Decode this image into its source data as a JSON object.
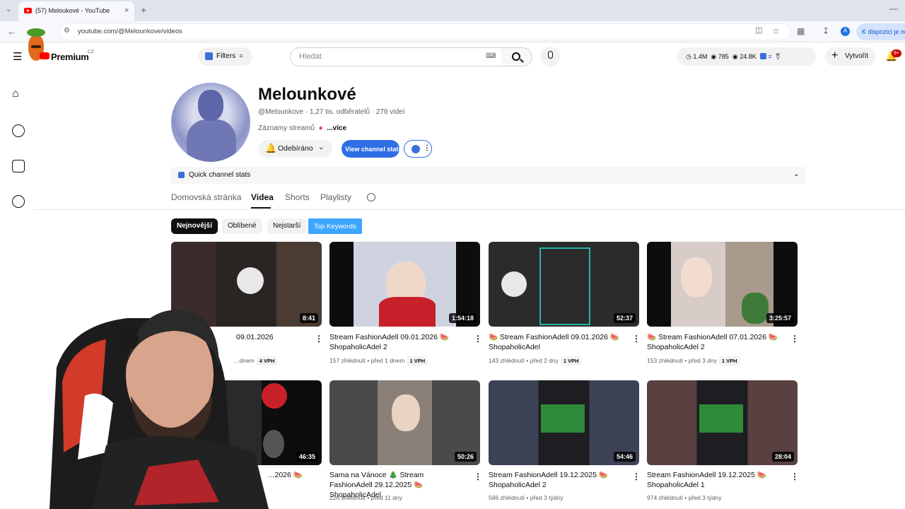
{
  "browser": {
    "tab_title": "(57) Meloukové - YouTube",
    "url": "youtube.com/@Melounkove/videos",
    "side_button": "K dispozici je nov"
  },
  "header": {
    "brand": "Premium",
    "region": "CZ",
    "filters_label": "Filters",
    "search_placeholder": "Hledat",
    "stats": {
      "views": "1.4M",
      "eye1": "785",
      "eye2": "24.8K"
    },
    "create_label": "Vytvořit",
    "notif_badge": "9+"
  },
  "channel": {
    "name": "Melounkové",
    "meta": "@Melounkove · 1,27 tis. odběratelů · 276 videí",
    "desc": "Záznamy streamů",
    "more": "...více",
    "subscribe_label": "Odebíráno",
    "vcs_label": "View channel stats",
    "quick_stats_label": "Quick channel stats"
  },
  "tabs": [
    "Domovská stránka",
    "Videa",
    "Shorts",
    "Playlisty"
  ],
  "chips": [
    "Nejnovější",
    "Oblíbené",
    "Nejstarší",
    "Top Keywords"
  ],
  "videos": [
    {
      "duration": "8:41",
      "title": "09.01.2026",
      "meta": "…dnem",
      "vph": "4 VPH"
    },
    {
      "duration": "1:54:18",
      "title": "Stream FashionAdell 09.01.2026 🍉 ShopaholicAdel 2",
      "meta": "157 zhlédnutí • před 1 dnem",
      "vph": "1 VPH"
    },
    {
      "duration": "52:37",
      "title": "🍉 Stream FashionAdell 09.01.2026 🍉 ShopaholicAdel",
      "meta": "143 zhlédnutí • před 2 dny",
      "vph": "1 VPH"
    },
    {
      "duration": "3:25:57",
      "title": "🍉 Stream FashionAdell 07.01.2026 🍉 ShopaholicAdel 2",
      "meta": "153 zhlédnutí • před 3 dny",
      "vph": "1 VPH"
    },
    {
      "duration": "46:35",
      "title": "…2026 🍉",
      "meta": "",
      "vph": ""
    },
    {
      "duration": "50:26",
      "title": "Sama na Vánoce 🎄 Stream FashionAdell 29.12.2025 🍉 ShopaholicAdel",
      "meta": "226 zhlédnutí • před 11 dny",
      "vph": ""
    },
    {
      "duration": "54:46",
      "title": "Stream FashionAdell 19.12.2025 🍉 ShopaholicAdel 2",
      "meta": "586 zhlédnutí • před 3 týdny",
      "vph": ""
    },
    {
      "duration": "28:04",
      "title": "Stream FashionAdell 19.12.2025 🍉 ShopaholicAdel 1",
      "meta": "974 zhlédnutí • před 3 týdny",
      "vph": ""
    }
  ]
}
